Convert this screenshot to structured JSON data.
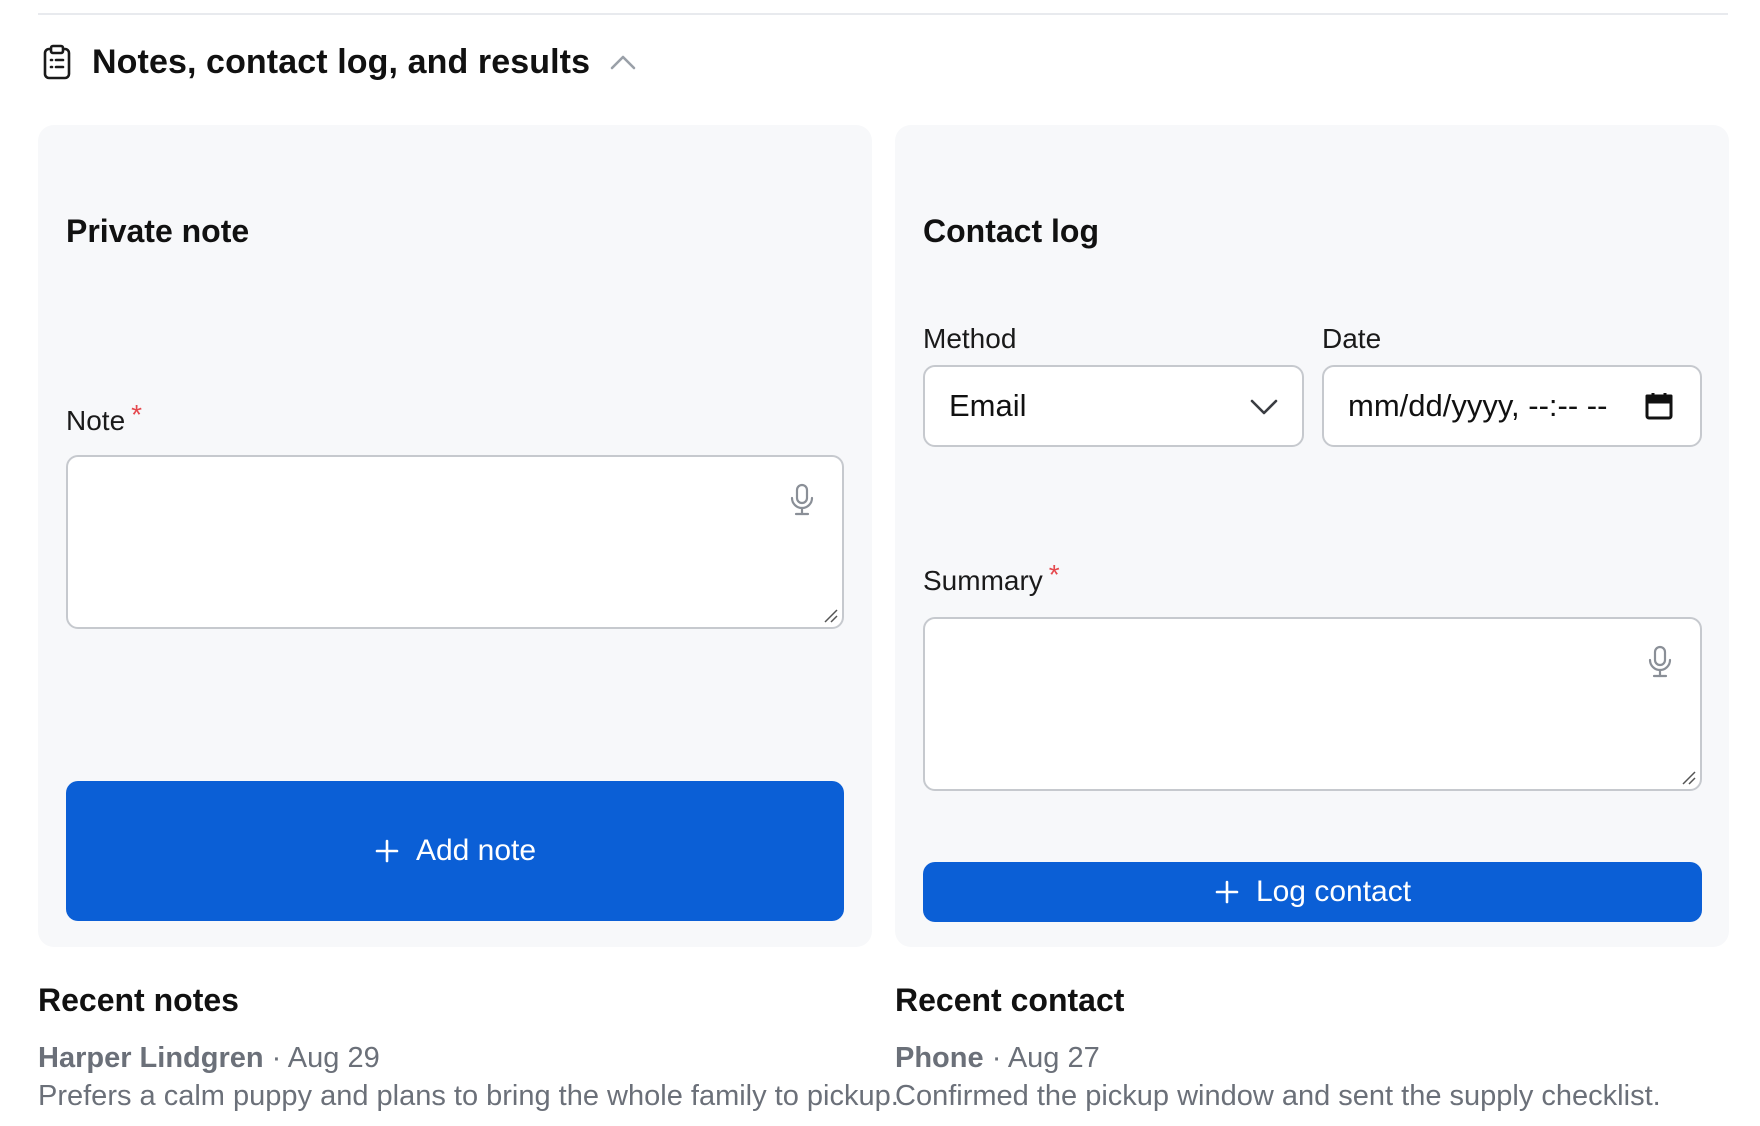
{
  "section": {
    "title": "Notes, contact log, and results",
    "icon": "clipboard-icon",
    "toggle_icon": "chevron-up-icon"
  },
  "private_note": {
    "title": "Private note",
    "note_label": "Note",
    "required_mark": "*",
    "note_value": "",
    "mic_icon": "microphone-icon",
    "add_button_label": "Add note"
  },
  "contact_log": {
    "title": "Contact log",
    "method_label": "Method",
    "method_value": "Email",
    "date_label": "Date",
    "date_placeholder": "mm/dd/yyyy, --:-- --",
    "summary_label": "Summary",
    "required_mark": "*",
    "summary_value": "",
    "log_button_label": "Log contact"
  },
  "recent_notes": {
    "title": "Recent notes",
    "items": [
      {
        "author": "Harper Lindgren",
        "date": "Aug 29",
        "text": "Prefers a calm puppy and plans to bring the whole family to pickup."
      }
    ]
  },
  "recent_contact": {
    "title": "Recent contact",
    "items": [
      {
        "method": "Phone",
        "date": "Aug 27",
        "text": "Confirmed the pickup window and sent the supply checklist."
      }
    ]
  },
  "colors": {
    "primary": "#0b5fd6",
    "required": "#e5484d",
    "card_bg": "#f7f8fa",
    "muted_text": "#6b7079"
  }
}
